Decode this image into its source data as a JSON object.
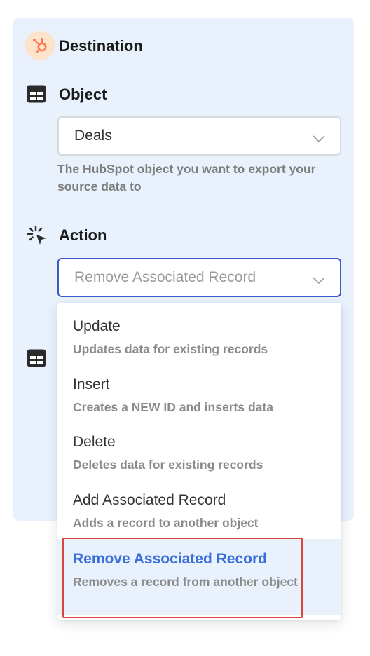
{
  "destination": {
    "title": "Destination",
    "icon": "hubspot-logo-icon",
    "brand_color": "#ff7a59"
  },
  "object": {
    "label": "Object",
    "icon": "table-icon",
    "selected_value": "Deals",
    "helper": "The HubSpot object you want to export your source data to"
  },
  "action": {
    "label": "Action",
    "icon": "cursor-click-icon",
    "selected_value": "Remove Associated Record",
    "options": [
      {
        "title": "Update",
        "desc": "Updates data for existing records"
      },
      {
        "title": "Insert",
        "desc": "Creates a NEW ID and inserts data"
      },
      {
        "title": "Delete",
        "desc": "Deletes data for existing records"
      },
      {
        "title": "Add Associated Record",
        "desc": "Adds a record to another object"
      },
      {
        "title": "Remove Associated Record",
        "desc": "Removes a record from another object"
      }
    ],
    "selected_index": 4
  },
  "colors": {
    "panel": "#e8f1fc",
    "accent": "#3a6fd8",
    "focus_border": "#3b5bcc",
    "highlight_box": "#d9453a"
  }
}
